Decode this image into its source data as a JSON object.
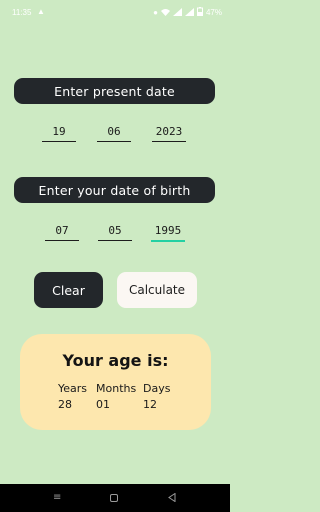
{
  "status_bar": {
    "time": "11:35",
    "battery": "47%"
  },
  "present_date": {
    "header": "Enter present date",
    "day": "19",
    "month": "06",
    "year": "2023"
  },
  "birth_date": {
    "header": "Enter your date of birth",
    "day": "07",
    "month": "05",
    "year": "1995"
  },
  "buttons": {
    "clear": "Clear",
    "calculate": "Calculate"
  },
  "result": {
    "title": "Your age is:",
    "years_label": "Years",
    "months_label": "Months",
    "days_label": "Days",
    "years": "28",
    "months": "01",
    "days": "12"
  },
  "colors": {
    "background": "#cdeac3",
    "dark": "#23272b",
    "card": "#fde7ae",
    "accent": "#24d0a3"
  }
}
